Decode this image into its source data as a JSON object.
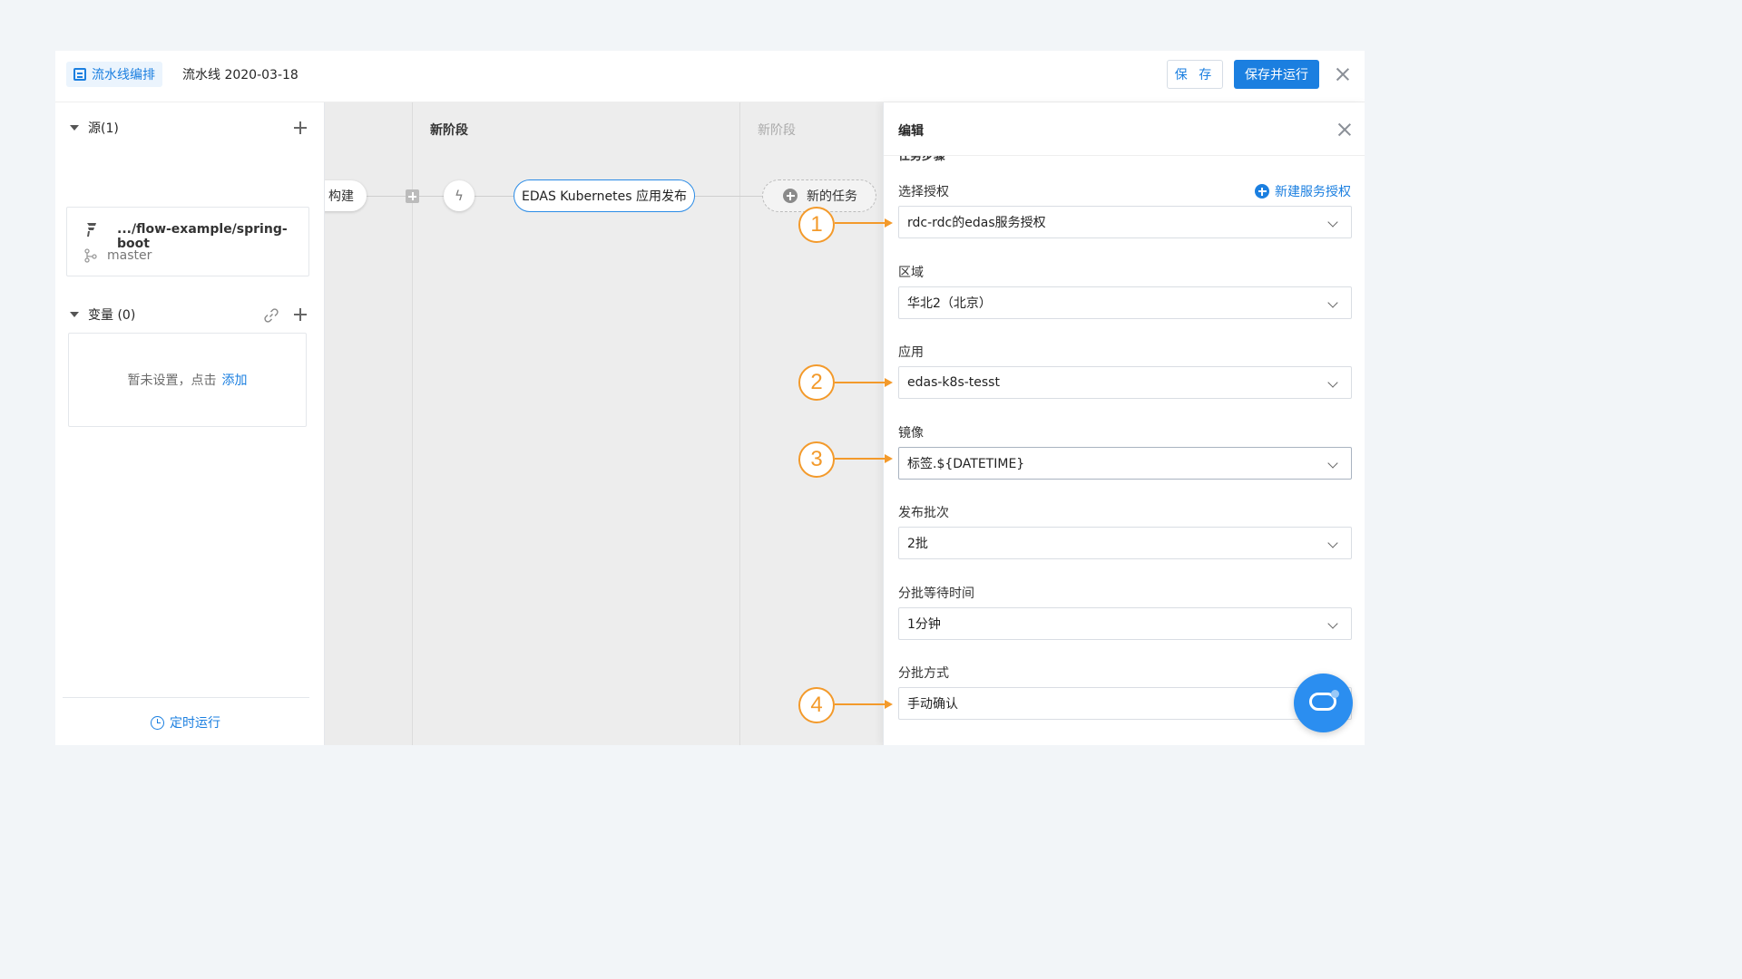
{
  "header": {
    "mode_label": "流水线编排",
    "pipeline_title": "流水线 2020-03-18",
    "save_label": "保 存",
    "save_run_label": "保存并运行"
  },
  "sidebar": {
    "source_title": "源(1)",
    "source_path": ".../flow-example/spring-boot",
    "source_branch": "master",
    "variables_title": "变量 (0)",
    "variables_empty": "暂未设置，点击",
    "variables_add": "添加",
    "timer_label": "定时运行"
  },
  "canvas": {
    "build_node": "构建",
    "stage1_label": "新阶段",
    "stage2_label": "新阶段",
    "task_node": "EDAS Kubernetes 应用发布",
    "new_task": "新的任务"
  },
  "panel": {
    "title": "编辑",
    "section_label": "任务步骤",
    "new_auth": "新建服务授权",
    "fields": [
      {
        "label": "选择授权",
        "value": "rdc-rdc的edas服务授权"
      },
      {
        "label": "区域",
        "value": "华北2（北京）"
      },
      {
        "label": "应用",
        "value": "edas-k8s-tesst"
      },
      {
        "label": "镜像",
        "value": "标签.${DATETIME}"
      },
      {
        "label": "发布批次",
        "value": "2批"
      },
      {
        "label": "分批等待时间",
        "value": "1分钟"
      },
      {
        "label": "分批方式",
        "value": "手动确认"
      }
    ]
  },
  "annotations": [
    "1",
    "2",
    "3",
    "4"
  ],
  "colors": {
    "accent": "#1b7fe0",
    "annotation": "#f39a2b"
  }
}
